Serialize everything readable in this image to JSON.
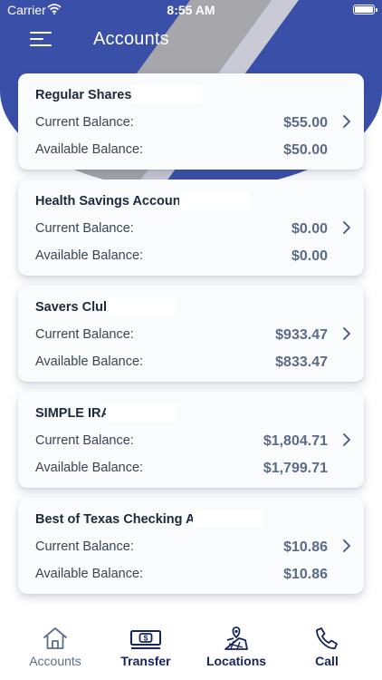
{
  "status_bar": {
    "carrier": "Carrier",
    "time": "8:55 AM"
  },
  "header": {
    "title": "Accounts"
  },
  "labels": {
    "current": "Current Balance:",
    "available": "Available Balance:"
  },
  "accounts": [
    {
      "name": "Regular Shares (",
      "current": "$55.00",
      "available": "$50.00"
    },
    {
      "name": "Health Savings Account",
      "current": "$0.00",
      "available": "$0.00"
    },
    {
      "name": "Savers Club",
      "current": "$933.47",
      "available": "$833.47"
    },
    {
      "name": "SIMPLE IRA",
      "current": "$1,804.71",
      "available": "$1,799.71"
    },
    {
      "name": "Best of Texas Checking Ac",
      "current": "$10.86",
      "available": "$10.86"
    }
  ],
  "tabs": [
    {
      "label": "Accounts",
      "icon": "home-icon"
    },
    {
      "label": "Transfer",
      "icon": "transfer-money-icon"
    },
    {
      "label": "Locations",
      "icon": "map-pin-icon"
    },
    {
      "label": "Call",
      "icon": "phone-icon"
    }
  ],
  "colors": {
    "header_blue": "#3a4fa8",
    "hero_gray": "#a6a6ab",
    "tab_inactive": "#5a6e8f",
    "tab_active": "#16245c",
    "amount": "#5b6b86"
  }
}
